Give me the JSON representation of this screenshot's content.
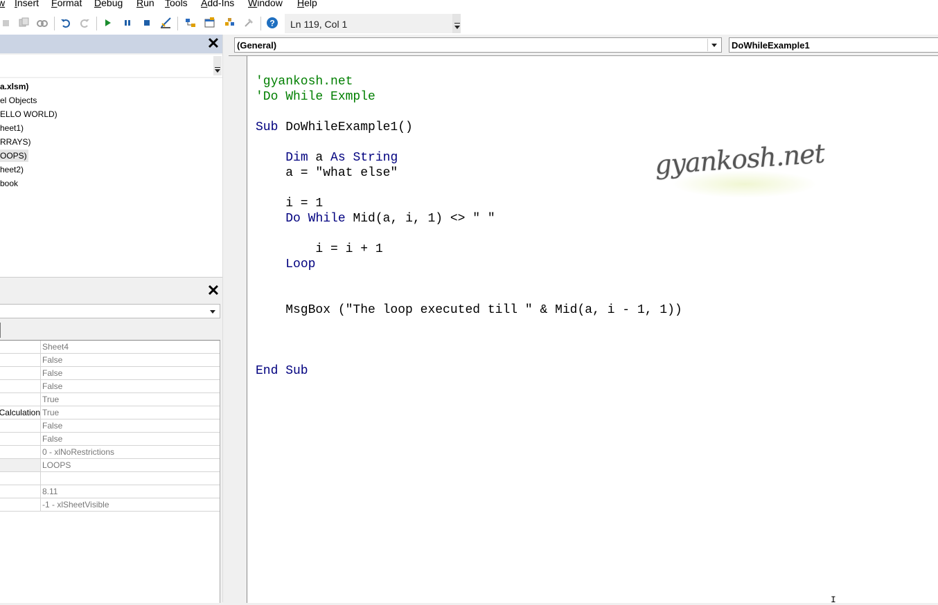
{
  "menu": {
    "items": [
      {
        "label": "w",
        "underline": "w",
        "rest": ""
      },
      {
        "label": "Insert",
        "underline": "I",
        "rest": "nsert"
      },
      {
        "label": "Format",
        "underline": "F",
        "rest": "ormat"
      },
      {
        "label": "Debug",
        "underline": "D",
        "rest": "ebug"
      },
      {
        "label": "Run",
        "underline": "R",
        "rest": "un"
      },
      {
        "label": "Tools",
        "underline": "T",
        "rest": "ools"
      },
      {
        "label": "Add-Ins",
        "underline": "A",
        "rest": "dd-Ins"
      },
      {
        "label": "Window",
        "underline": "W",
        "rest": "indow"
      },
      {
        "label": "Help",
        "underline": "H",
        "rest": "elp"
      }
    ]
  },
  "toolbar": {
    "status": "Ln 119, Col 1",
    "help_glyph": "?"
  },
  "project": {
    "close_glyph": "✕",
    "tree": [
      {
        "label": "a.xlsm)",
        "bold": true
      },
      {
        "label": "el Objects",
        "bold": false
      },
      {
        "label": "ELLO WORLD)",
        "bold": false
      },
      {
        "label": "heet1)",
        "bold": false
      },
      {
        "label": "RRAYS)",
        "bold": false
      },
      {
        "label": "OOPS)",
        "bold": false,
        "selected": true
      },
      {
        "label": "heet2)",
        "bold": false
      },
      {
        "label": "book",
        "bold": false
      }
    ]
  },
  "properties": {
    "close_glyph": "✕",
    "rows": [
      {
        "name": "",
        "value": "Sheet4"
      },
      {
        "name": "",
        "value": "False"
      },
      {
        "name": "",
        "value": "False"
      },
      {
        "name": "",
        "value": "False"
      },
      {
        "name": "",
        "value": "True"
      },
      {
        "name": "Calculation",
        "value": "True"
      },
      {
        "name": "",
        "value": "False"
      },
      {
        "name": "",
        "value": "False"
      },
      {
        "name": "",
        "value": "0 - xlNoRestrictions"
      },
      {
        "name": "",
        "value": "LOOPS",
        "gray": true
      },
      {
        "name": "",
        "value": ""
      },
      {
        "name": "",
        "value": "8.11"
      },
      {
        "name": "",
        "value": "-1 - xlSheetVisible"
      }
    ]
  },
  "code_window": {
    "object_combo": "(General)",
    "procedure_combo": "DoWhileExample1",
    "watermark": "gyankosh.net",
    "lines": [
      [
        {
          "t": "cm",
          "s": "'gyankosh.net"
        }
      ],
      [
        {
          "t": "cm",
          "s": "'Do While Exmple"
        }
      ],
      [],
      [
        {
          "t": "kw",
          "s": "Sub"
        },
        {
          "t": "tx",
          "s": " DoWhileExample1()"
        }
      ],
      [],
      [
        {
          "t": "tx",
          "s": "    "
        },
        {
          "t": "kw",
          "s": "Dim"
        },
        {
          "t": "tx",
          "s": " a "
        },
        {
          "t": "kw",
          "s": "As"
        },
        {
          "t": "tx",
          "s": " "
        },
        {
          "t": "kw",
          "s": "String"
        }
      ],
      [
        {
          "t": "tx",
          "s": "    a = \"what else\""
        }
      ],
      [],
      [
        {
          "t": "tx",
          "s": "    i = 1"
        }
      ],
      [
        {
          "t": "tx",
          "s": "    "
        },
        {
          "t": "kw",
          "s": "Do"
        },
        {
          "t": "tx",
          "s": " "
        },
        {
          "t": "kw",
          "s": "While"
        },
        {
          "t": "tx",
          "s": " Mid(a, i, 1) <> \" \""
        }
      ],
      [],
      [
        {
          "t": "tx",
          "s": "        i = i + 1"
        }
      ],
      [
        {
          "t": "tx",
          "s": "    "
        },
        {
          "t": "kw",
          "s": "Loop"
        }
      ],
      [],
      [],
      [
        {
          "t": "tx",
          "s": "    MsgBox (\"The loop executed till \" & Mid(a, i - 1, 1))"
        }
      ],
      [],
      [],
      [],
      [
        {
          "t": "kw",
          "s": "End Sub"
        }
      ]
    ],
    "cursor_glyph": "I"
  }
}
